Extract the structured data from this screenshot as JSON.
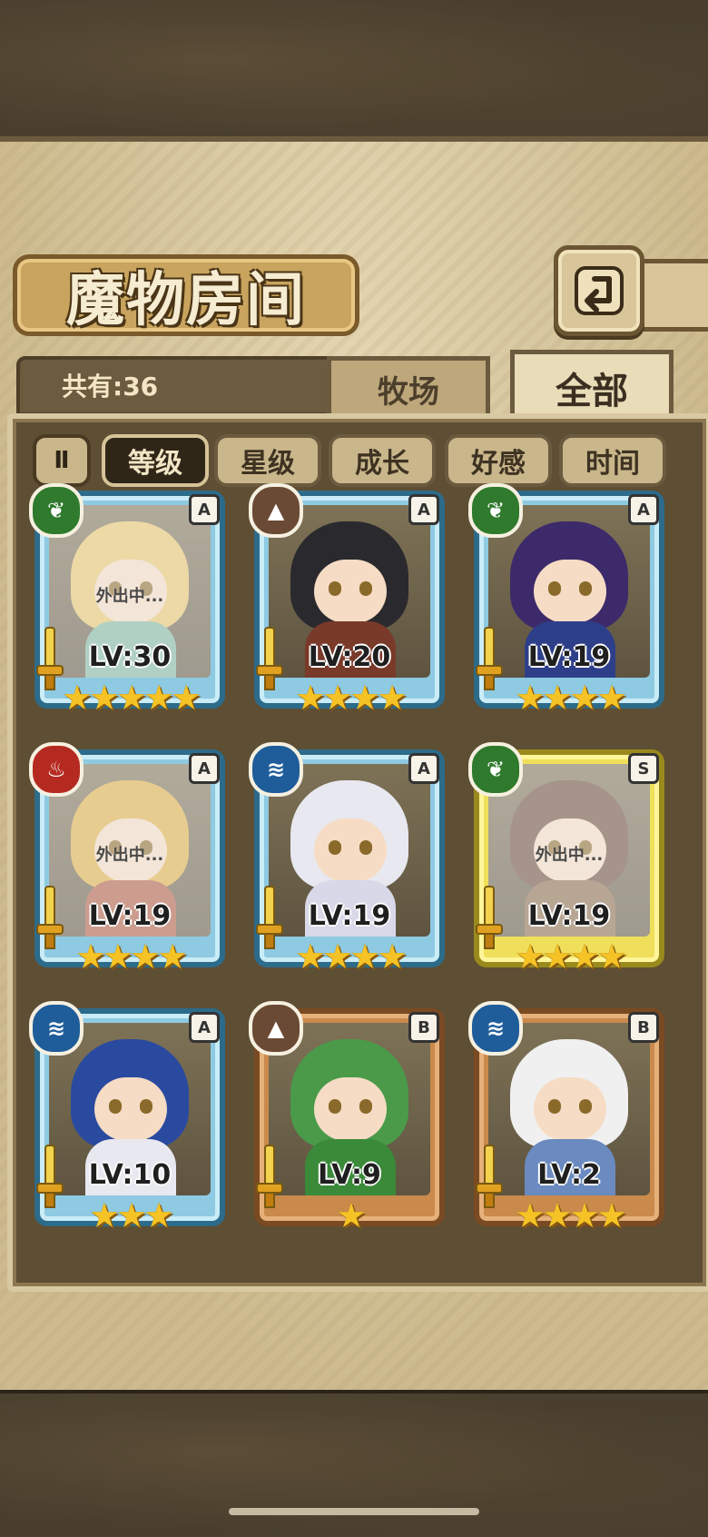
{
  "header": {
    "title": "魔物房间",
    "back_icon": "return-arrow-icon"
  },
  "tabs": {
    "count_label": "共有:36",
    "farm": "牧场",
    "all": "全部",
    "active": "全部"
  },
  "sort": {
    "toggle_label": "Ⅱ",
    "buttons": [
      "等级",
      "星级",
      "成长",
      "好感",
      "时间"
    ],
    "active": "等级"
  },
  "monsters": [
    {
      "element": "leaf",
      "element_icon": "leaf-icon",
      "rank": "A",
      "level": "LV:30",
      "stars": 5,
      "away": true,
      "away_text": "外出中..."
    },
    {
      "element": "earth",
      "element_icon": "mountain-icon",
      "rank": "A",
      "level": "LV:20",
      "stars": 4,
      "away": false
    },
    {
      "element": "leaf",
      "element_icon": "leaf-icon",
      "rank": "A",
      "level": "LV:19",
      "stars": 4,
      "away": false
    },
    {
      "element": "fire",
      "element_icon": "flame-icon",
      "rank": "A",
      "level": "LV:19",
      "stars": 4,
      "away": true,
      "away_text": "外出中..."
    },
    {
      "element": "water",
      "element_icon": "wave-icon",
      "rank": "A",
      "level": "LV:19",
      "stars": 4,
      "away": false
    },
    {
      "element": "leaf",
      "element_icon": "leaf-icon",
      "rank": "S",
      "level": "LV:19",
      "stars": 4,
      "away": true,
      "away_text": "外出中..."
    },
    {
      "element": "water",
      "element_icon": "wave-icon",
      "rank": "A",
      "level": "LV:10",
      "stars": 3,
      "away": false
    },
    {
      "element": "earth",
      "element_icon": "mountain-icon",
      "rank": "B",
      "level": "LV:9",
      "stars": 1,
      "away": false
    },
    {
      "element": "water",
      "element_icon": "wave-icon",
      "rank": "B",
      "level": "LV:2",
      "stars": 4,
      "away": false
    }
  ],
  "colors": {
    "rank_a": "#8ecae2",
    "rank_s": "#f0df5a",
    "rank_b": "#c98a4c",
    "star": "#f6c326"
  }
}
